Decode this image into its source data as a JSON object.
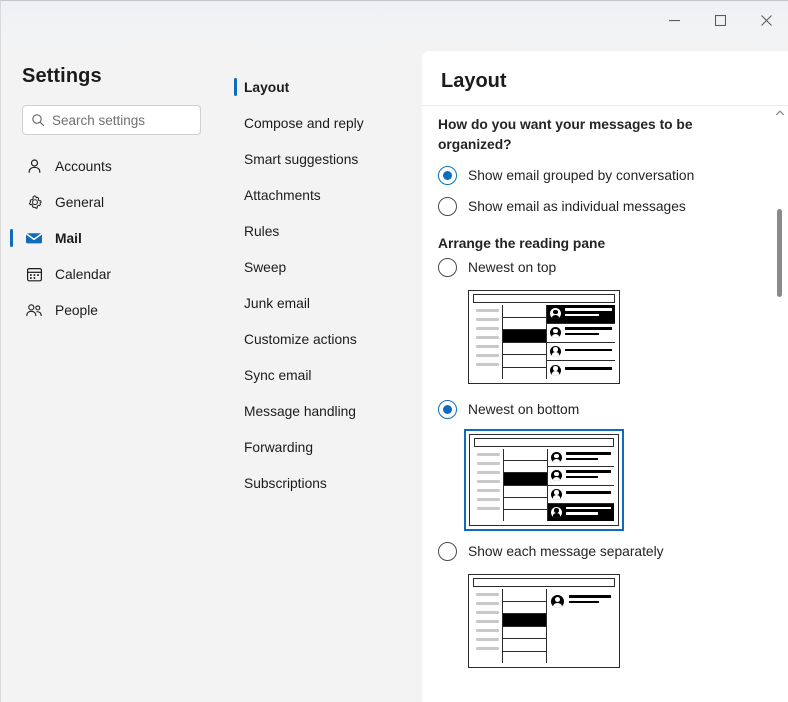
{
  "window": {
    "controls": [
      {
        "name": "minimize",
        "label": "Minimize"
      },
      {
        "name": "maximize",
        "label": "Maximize"
      },
      {
        "name": "close",
        "label": "Close"
      }
    ]
  },
  "sidebar": {
    "title": "Settings",
    "search": {
      "placeholder": "Search settings",
      "value": "",
      "icon": "search-icon"
    },
    "items": [
      {
        "label": "Accounts",
        "icon": "person-icon",
        "selected": false
      },
      {
        "label": "General",
        "icon": "gear-icon",
        "selected": false
      },
      {
        "label": "Mail",
        "icon": "mail-icon",
        "selected": true
      },
      {
        "label": "Calendar",
        "icon": "calendar-icon",
        "selected": false
      },
      {
        "label": "People",
        "icon": "people-icon",
        "selected": false
      }
    ]
  },
  "midnav": {
    "items": [
      {
        "label": "Layout",
        "selected": true
      },
      {
        "label": "Compose and reply",
        "selected": false
      },
      {
        "label": "Smart suggestions",
        "selected": false
      },
      {
        "label": "Attachments",
        "selected": false
      },
      {
        "label": "Rules",
        "selected": false
      },
      {
        "label": "Sweep",
        "selected": false
      },
      {
        "label": "Junk email",
        "selected": false
      },
      {
        "label": "Customize actions",
        "selected": false
      },
      {
        "label": "Sync email",
        "selected": false
      },
      {
        "label": "Message handling",
        "selected": false
      },
      {
        "label": "Forwarding",
        "selected": false
      },
      {
        "label": "Subscriptions",
        "selected": false
      }
    ]
  },
  "content": {
    "title": "Layout",
    "question": "How do you want your messages to be organized?",
    "organize_options": [
      {
        "label": "Show email grouped by conversation",
        "selected": true
      },
      {
        "label": "Show email as individual messages",
        "selected": false
      }
    ],
    "reading_pane_heading": "Arrange the reading pane",
    "reading_pane_options": [
      {
        "label": "Newest on top",
        "selected": false,
        "preview": "newest-on-top-preview"
      },
      {
        "label": "Newest on bottom",
        "selected": true,
        "preview": "newest-on-bottom-preview"
      },
      {
        "label": "Show each message separately",
        "selected": false,
        "preview": "each-message-separately-preview"
      }
    ]
  },
  "colors": {
    "accent": "#0f6cbd",
    "window_background": "#f3f3f3",
    "content_background": "#ffffff",
    "text": "#242424",
    "scrollbar_thumb": "#8a8a8a"
  }
}
